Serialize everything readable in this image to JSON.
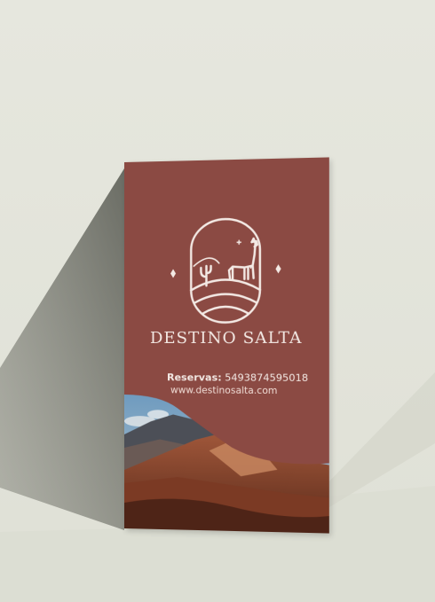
{
  "brand": {
    "name": "DESTINO SALTA",
    "reservations_label": "Reservas:",
    "reservations_number": "5493874595018",
    "website": "www.destinosalta.com"
  },
  "icons": [
    "llama-landscape-logo-icon",
    "diamond-icon"
  ],
  "colors": {
    "card": "#8b4a43",
    "card_text": "#f3e9e4",
    "background": "#e3e4da",
    "shadow": "#6e6f68"
  }
}
